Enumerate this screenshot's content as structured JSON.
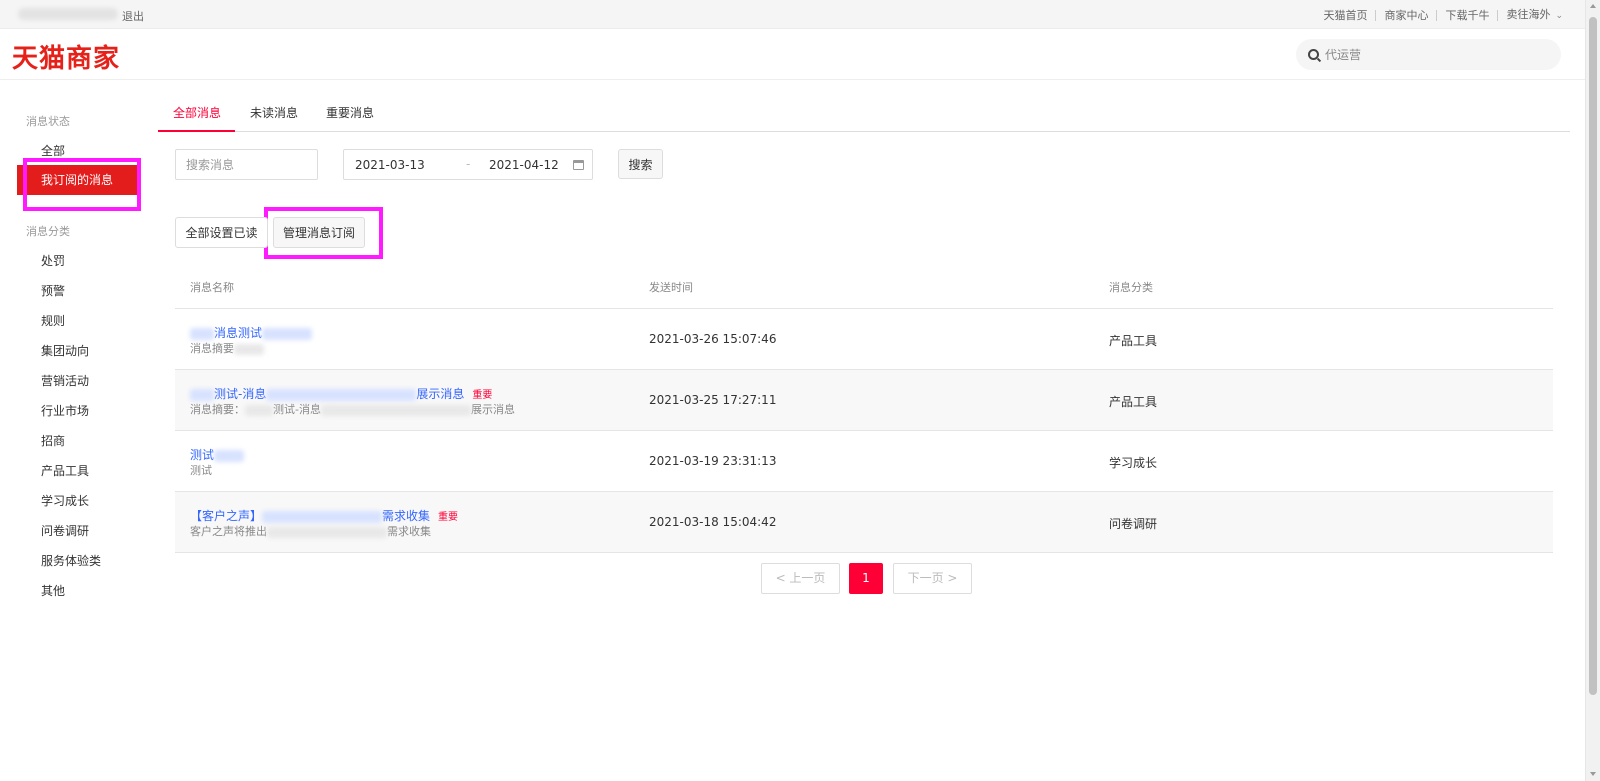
{
  "topbar": {
    "logout": "退出",
    "links": [
      "天猫首页",
      "商家中心",
      "下载千牛",
      "卖往海外"
    ]
  },
  "header": {
    "logo": "天猫商家",
    "search_placeholder": "代运营"
  },
  "sidebar": {
    "status_title": "消息状态",
    "status_items": [
      "全部",
      "我订阅的消息"
    ],
    "category_title": "消息分类",
    "category_items": [
      "处罚",
      "预警",
      "规则",
      "集团动向",
      "营销活动",
      "行业市场",
      "招商",
      "产品工具",
      "学习成长",
      "问卷调研",
      "服务体验类",
      "其他"
    ]
  },
  "tabs": [
    "全部消息",
    "未读消息",
    "重要消息"
  ],
  "filters": {
    "keyword_placeholder": "搜索消息",
    "start_date": "2021-03-13",
    "range_sep": "-",
    "end_date": "2021-04-12",
    "search_button": "搜索"
  },
  "actions": {
    "mark_all_read": "全部设置已读",
    "manage_subscription": "管理消息订阅"
  },
  "table": {
    "headers": [
      "消息名称",
      "发送时间",
      "消息分类"
    ],
    "rows": [
      {
        "title_visible": [
          "消息测试"
        ],
        "summary_visible": [
          "消息摘要"
        ],
        "important": "",
        "time": "2021-03-26 15:07:46",
        "category": "产品工具"
      },
      {
        "title_visible": [
          "测试-消息",
          "展示消息"
        ],
        "summary_visible": [
          "消息摘要：",
          "测试-消息",
          "展示消息"
        ],
        "important": "重要",
        "time": "2021-03-25 17:27:11",
        "category": "产品工具"
      },
      {
        "title_visible": [
          "测试"
        ],
        "summary_visible": [
          "测试"
        ],
        "important": "",
        "time": "2021-03-19 23:31:13",
        "category": "学习成长"
      },
      {
        "title_visible": [
          "【客户之声】",
          "需求收集"
        ],
        "summary_visible": [
          "客户之声将推出",
          "需求收集"
        ],
        "important": "重要",
        "time": "2021-03-18 15:04:42",
        "category": "问卷调研"
      }
    ]
  },
  "pagination": {
    "prev": "< 上一页",
    "current": "1",
    "next": "下一页 >"
  }
}
